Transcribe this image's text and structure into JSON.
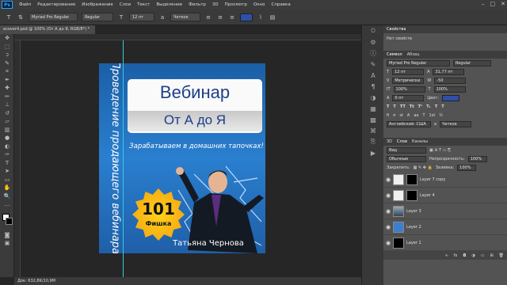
{
  "app": {
    "logo": "Ps",
    "menu": [
      "Файл",
      "Редактирование",
      "Изображение",
      "Слои",
      "Текст",
      "Выделение",
      "Фильтр",
      "3D",
      "Просмотр",
      "Окно",
      "Справка"
    ]
  },
  "options": {
    "font_family": "Myriad Pro Regular",
    "font_style": "Regular",
    "font_size": "12 пт",
    "aa": "Четкое",
    "color": "#2f4fa8"
  },
  "document": {
    "tab": "ecover4.psd @ 100% (От А до Я, RGB/8*) *",
    "status": "Док: 632,8K/10,9M"
  },
  "cover": {
    "vertical": "Проведение продающего вебинара",
    "title1": "Вебинар",
    "title2": "От А до Я",
    "slogan": "Зарабатываем в домашних тапочках!",
    "badge_num": "101",
    "badge_word": "Фишка",
    "author": "Татьяна Чернова",
    "bg": "#2a7fcf"
  },
  "panels": {
    "properties": {
      "tab": "Свойства",
      "sub": "Нет свойств"
    },
    "character": {
      "tab1": "Символ",
      "tab2": "Абзац",
      "font": "Myriad Pro Regular",
      "style": "Regular",
      "size": "12 пт",
      "leading": "31,77 пт",
      "kerning": "Метрически",
      "tracking": "-50",
      "vscale": "100%",
      "hscale": "100%",
      "baseline": "0 пт",
      "color_label": "Цвет:",
      "lang": "Английский: США",
      "aa": "Четкое"
    },
    "layers": {
      "tab1": "3D",
      "tab2": "Слои",
      "tab3": "Каналы",
      "kind": "Вид",
      "blend": "Обычные",
      "opacity_label": "Непрозрачность:",
      "opacity": "100%",
      "lock_label": "Закрепить:",
      "fill_label": "Заливка:",
      "fill": "100%",
      "items": [
        {
          "name": "Layer 7 copy"
        },
        {
          "name": "Layer 4"
        },
        {
          "name": "Layer 3"
        },
        {
          "name": "Layer 2"
        },
        {
          "name": "Layer 1"
        }
      ]
    }
  }
}
